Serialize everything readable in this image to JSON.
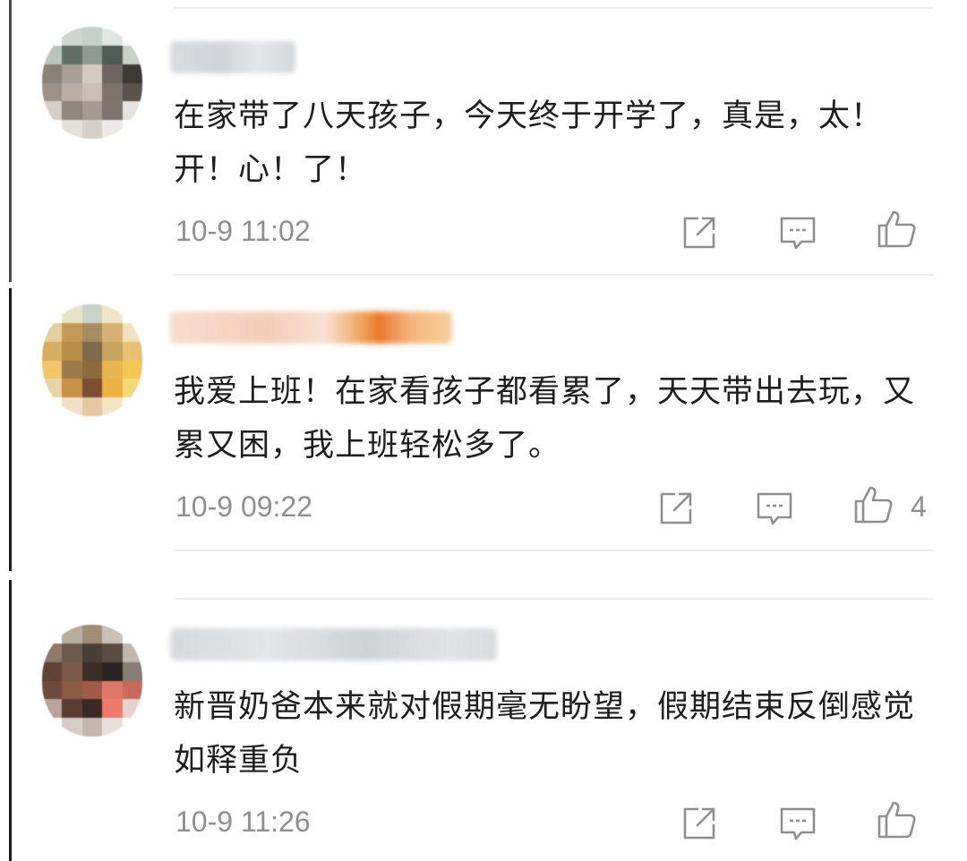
{
  "comments": [
    {
      "text": "在家带了八天孩子，今天终于开学了，真是，太！开！心！了！",
      "time": "10-9 11:02",
      "likes": ""
    },
    {
      "text": "我爱上班！在家看孩子都看累了，天天带出去玩，又累又困，我上班轻松多了。",
      "time": "10-9 09:22",
      "likes": "4"
    },
    {
      "text": "新晋奶爸本来就对假期毫无盼望，假期结束反倒感觉如释重负",
      "time": "10-9 11:26",
      "likes": ""
    }
  ],
  "icons": {
    "share": "share-icon",
    "reply": "comment-icon",
    "like": "thumbs-up-icon"
  },
  "colors": {
    "text": "#1e1e1e",
    "meta": "#8f8f8f",
    "divider": "#ececec"
  }
}
